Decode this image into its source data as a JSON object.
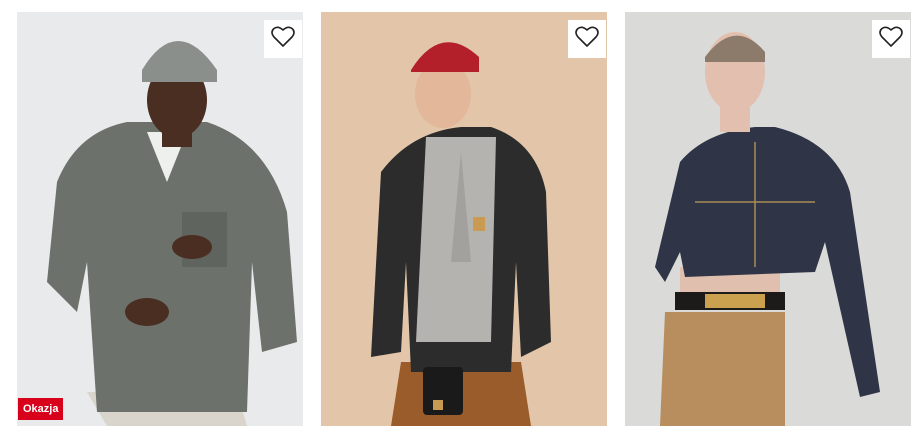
{
  "products": [
    {
      "image": "man-grey-denim-jacket-beanie",
      "favorite_icon": "heart-outline-icon",
      "badge": "Okazja",
      "badge_color": "#d8001a"
    },
    {
      "image": "man-black-carhartt-denim-jacket-red-cap",
      "favorite_icon": "heart-outline-icon",
      "badge": null
    },
    {
      "image": "man-cropped-raw-denim-jacket-moschino-belt",
      "favorite_icon": "heart-outline-icon",
      "badge": null
    }
  ]
}
